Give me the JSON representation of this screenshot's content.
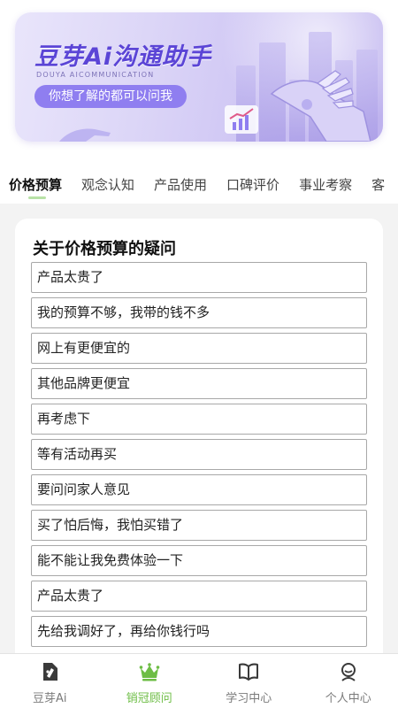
{
  "banner": {
    "title": "豆芽Ai沟通助手",
    "subtitle": "DOUYA AICOMMUNICATION",
    "prompt": "你想了解的都可以问我"
  },
  "tabs": [
    {
      "label": "价格预算",
      "active": true
    },
    {
      "label": "观念认知",
      "active": false
    },
    {
      "label": "产品使用",
      "active": false
    },
    {
      "label": "口碑评价",
      "active": false
    },
    {
      "label": "事业考察",
      "active": false
    },
    {
      "label": "客",
      "active": false
    }
  ],
  "section": {
    "title": "关于价格预算的疑问",
    "questions": [
      "产品太贵了",
      "我的预算不够，我带的钱不多",
      "网上有更便宜的",
      "其他品牌更便宜",
      "再考虑下",
      "等有活动再买",
      "要问问家人意见",
      "买了怕后悔，我怕买错了",
      "能不能让我免费体验一下",
      "产品太贵了",
      "先给我调好了，再给你钱行吗"
    ]
  },
  "bottom_nav": {
    "items": [
      {
        "label": "豆芽Ai",
        "icon": "doc-pen-icon",
        "active": false
      },
      {
        "label": "销冠顾问",
        "icon": "crown-icon",
        "active": true
      },
      {
        "label": "学习中心",
        "icon": "book-icon",
        "active": false
      },
      {
        "label": "个人中心",
        "icon": "person-icon",
        "active": false
      }
    ],
    "active_color": "#6dbd45",
    "inactive_color": "#7a7a7a"
  },
  "colors": {
    "banner_accent": "#5b45d6",
    "pill": "#8f7ef0",
    "tab_indicator": "#b8e2a6",
    "page_background": "#f3f3f3"
  }
}
